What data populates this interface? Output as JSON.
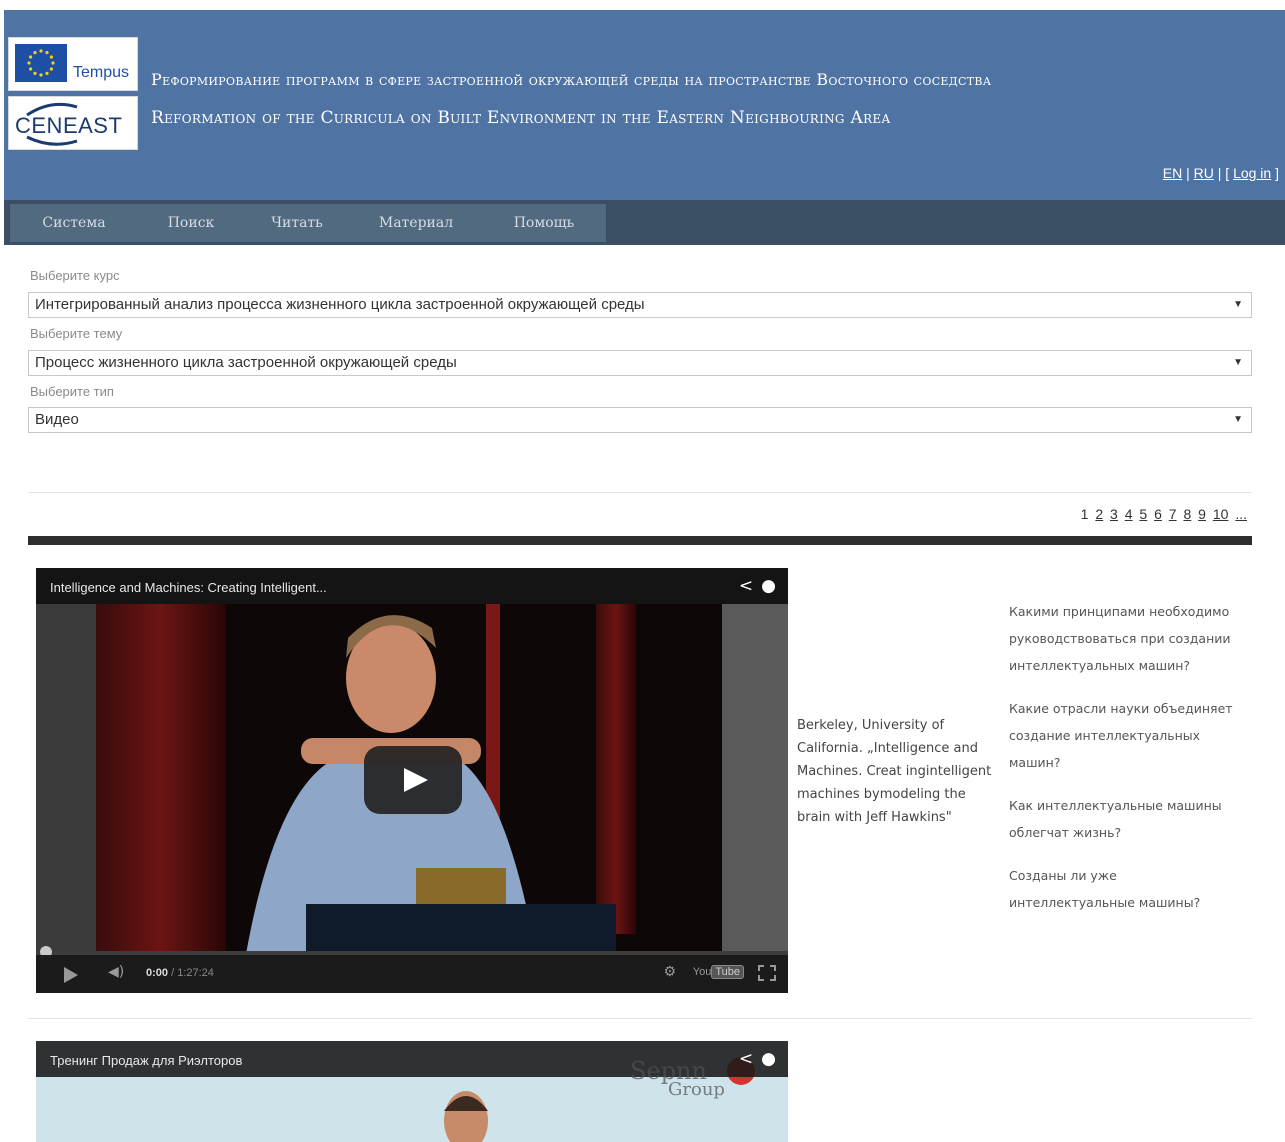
{
  "header": {
    "tempus_logo_text": "Tempus",
    "ceneast_logo_text": "CENEAST",
    "title_ru": "Реформирование программ в сфере застроенной окружающей среды на пространстве Восточного соседства",
    "title_en": "Reformation of the Curricula on Built Environment in the Eastern Neighbouring Area",
    "lang_en": "EN",
    "lang_ru": "RU",
    "login": "Log in",
    "sep": " | ",
    "bracket_open": "[ ",
    "bracket_close": " ]"
  },
  "nav": {
    "items": [
      "Система",
      "Поиск",
      "Читать",
      "Материал",
      "Помощь"
    ]
  },
  "form": {
    "course_label": "Выберите курс",
    "course_value": "Интегрированный анализ процесса жизненного цикла застроенной окружающей среды",
    "topic_label": "Выберите тему",
    "topic_value": "Процесс жизненного цикла застроенной окружающей среды",
    "type_label": "Выберите тип",
    "type_value": "Видео",
    "arrow": "▼"
  },
  "pager": {
    "current": "1",
    "pages": [
      "2",
      "3",
      "4",
      "5",
      "6",
      "7",
      "8",
      "9",
      "10"
    ],
    "more": "..."
  },
  "video1": {
    "title": "Intelligence and Machines: Creating Intelligent...",
    "time_current": "0:00",
    "time_total": "/ 1:27:24",
    "yt_label": "You",
    "yt_box": "Tube",
    "caption": "Berkeley, University of California. „Intelligence and Machines. Creat ingintelligent machines bymodeling the brain with Jeff Hawkins\"",
    "questions": [
      "Какими принципами необходимо руководствоваться при создании интеллектуальных машин?",
      "Какие отрасли науки объединяет создание интеллектуальных машин?",
      "Как интеллектуальные машины облегчат жизнь?",
      "Созданы ли уже интеллектуальные машины?"
    ]
  },
  "video2": {
    "title": "Тренинг Продаж для Риэлторов",
    "watermark_top": "Sepnn",
    "watermark_bottom": "Group"
  },
  "colors": {
    "header_bg": "#4f73a3",
    "nav_bg": "#3a4f63",
    "nav_item_bg": "#526a80"
  }
}
